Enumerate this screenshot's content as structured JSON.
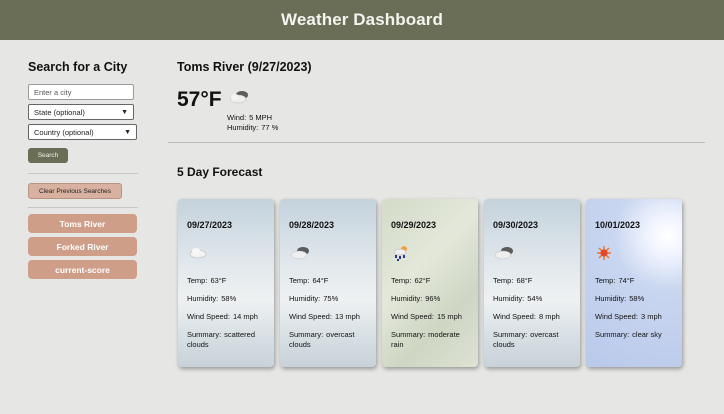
{
  "header": {
    "title": "Weather Dashboard"
  },
  "sidebar": {
    "title": "Search for a City",
    "city_placeholder": "Enter a city",
    "state_select": "State (optional)",
    "country_select": "Country (optional)",
    "search_label": "Search",
    "clear_label": "Clear Previous Searches",
    "history": [
      "Toms River",
      "Forked River",
      "current-score"
    ]
  },
  "current": {
    "title": "Toms River (9/27/2023)",
    "temp": "57°F",
    "wind_label": "Wind:",
    "wind": "5 MPH",
    "humidity_label": "Humidity:",
    "humidity": "77 %",
    "icon": "cloudy-icon"
  },
  "forecast": {
    "title": "5 Day Forecast",
    "labels": {
      "temp": "Temp:",
      "humidity": "Humidity:",
      "wind": "Wind Speed:",
      "summary": "Summary:"
    },
    "days": [
      {
        "date": "09/27/2023",
        "temp": "63°F",
        "humidity": "58%",
        "wind": "14 mph",
        "summary": "scattered clouds",
        "icon": "cloud-icon"
      },
      {
        "date": "09/28/2023",
        "temp": "64°F",
        "humidity": "75%",
        "wind": "13 mph",
        "summary": "overcast clouds",
        "icon": "overcast-icon"
      },
      {
        "date": "09/29/2023",
        "temp": "62°F",
        "humidity": "96%",
        "wind": "15 mph",
        "summary": "moderate rain",
        "icon": "rain-icon"
      },
      {
        "date": "09/30/2023",
        "temp": "68°F",
        "humidity": "54%",
        "wind": "8 mph",
        "summary": "overcast clouds",
        "icon": "overcast-icon"
      },
      {
        "date": "10/01/2023",
        "temp": "74°F",
        "humidity": "58%",
        "wind": "3 mph",
        "summary": "clear sky",
        "icon": "sun-icon"
      }
    ]
  }
}
